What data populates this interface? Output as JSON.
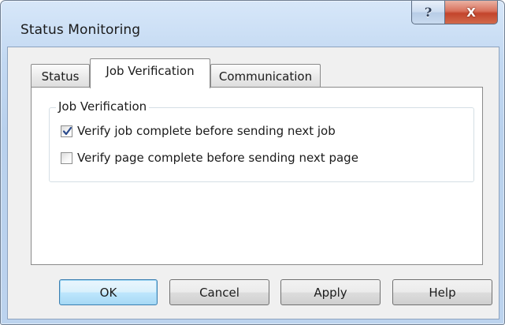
{
  "window": {
    "title": "Status Monitoring",
    "help_glyph": "?",
    "close_glyph": "X"
  },
  "tabs": [
    {
      "label": "Status",
      "selected": false
    },
    {
      "label": "Job Verification",
      "selected": true
    },
    {
      "label": "Communication",
      "selected": false
    }
  ],
  "group": {
    "legend": "Job Verification",
    "options": [
      {
        "label": "Verify job complete before sending next job",
        "checked": true
      },
      {
        "label": "Verify page complete before sending next page",
        "checked": false
      }
    ]
  },
  "buttons": {
    "ok": "OK",
    "cancel": "Cancel",
    "apply": "Apply",
    "help": "Help"
  },
  "colors": {
    "accent_default_button": "#3c7fb1",
    "close_button": "#c3452c",
    "frame": "#bcd3ee"
  },
  "icons": {
    "help": "help-question-icon",
    "close": "close-x-icon",
    "check": "checkmark-icon"
  }
}
